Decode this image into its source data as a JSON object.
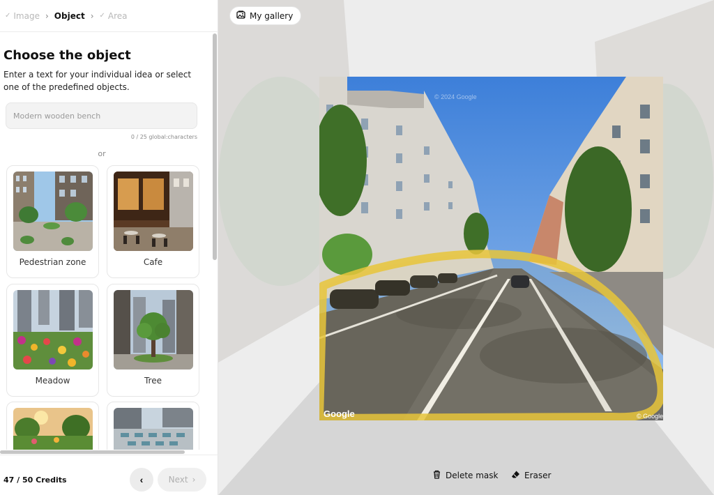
{
  "steps": [
    {
      "label": "Image",
      "state": "done"
    },
    {
      "label": "Object",
      "state": "active"
    },
    {
      "label": "Area",
      "state": "pending"
    }
  ],
  "panel": {
    "title": "Choose the object",
    "description": "Enter a text for your individual idea or select one of the predefined objects.",
    "input_placeholder": "Modern wooden bench",
    "char_count": "0 / 25 global:characters",
    "or_text": "or"
  },
  "objects": [
    {
      "label": "Pedestrian zone"
    },
    {
      "label": "Cafe"
    },
    {
      "label": "Meadow"
    },
    {
      "label": "Tree"
    },
    {
      "label": ""
    },
    {
      "label": ""
    }
  ],
  "footer": {
    "credits": "47 / 50 Credits",
    "next_label": "Next"
  },
  "main": {
    "gallery_label": "My gallery",
    "delete_mask_label": "Delete mask",
    "eraser_label": "Eraser",
    "watermark_left": "Google",
    "watermark_right": "© Google",
    "watermark_top": "© 2024 Google"
  },
  "colors": {
    "mask": "#e8c53a",
    "sky": "#4f8fe0",
    "accent": "#111111"
  }
}
